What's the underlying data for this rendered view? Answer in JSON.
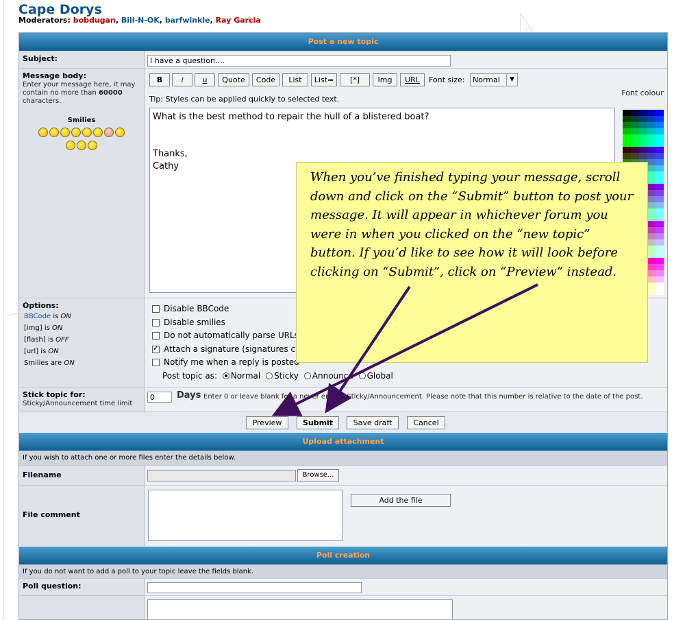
{
  "forum": {
    "title": "Cape Dorys",
    "moderators_label": "Moderators:",
    "moderators": [
      {
        "name": "bobdugan",
        "color": "#aa0000"
      },
      {
        "name": "Bill-N-OK",
        "color": "#105289"
      },
      {
        "name": "barfwinkle",
        "color": "#105289"
      },
      {
        "name": "Ray Garcia",
        "color": "#aa0000"
      }
    ]
  },
  "post": {
    "header": "Post a new topic",
    "subject_label": "Subject:",
    "subject_value": "I have a question....",
    "message_label": "Message body:",
    "message_help_1": "Enter your message here, it may contain no more than",
    "message_help_count": "60000",
    "message_help_2": "characters.",
    "smilies_label": "Smilies",
    "bbcode_buttons": [
      "B",
      "i",
      "u",
      "Quote",
      "Code",
      "List",
      "List=",
      "[*]",
      "Img",
      "URL"
    ],
    "font_size_label": "Font size:",
    "font_size_value": "Normal",
    "tip": "Tip: Styles can be applied quickly to selected text.",
    "font_colour_label": "Font colour",
    "message_lines": [
      "What is the best method to repair the hull of a blistered boat?",
      "",
      "",
      "Thanks,",
      "Cathy"
    ]
  },
  "options": {
    "label": "Options:",
    "status": [
      {
        "name": "BBCode",
        "link": true,
        "suffix": " is ",
        "state": "ON"
      },
      {
        "name": "[img]",
        "link": false,
        "suffix": " is ",
        "state": "ON"
      },
      {
        "name": "[flash]",
        "link": false,
        "suffix": " is ",
        "state": "OFF"
      },
      {
        "name": "[url]",
        "link": false,
        "suffix": " is ",
        "state": "ON"
      },
      {
        "name": "Smilies",
        "link": false,
        "suffix": " are ",
        "state": "ON"
      }
    ],
    "checkboxes": [
      {
        "label": "Disable BBCode",
        "checked": false
      },
      {
        "label": "Disable smilies",
        "checked": false
      },
      {
        "label": "Do not automatically parse URLs",
        "checked": false
      },
      {
        "label": "Attach a signature (signatures can be altered via the UCP)",
        "checked": true
      },
      {
        "label": "Notify me when a reply is posted",
        "checked": false
      }
    ],
    "post_as_label": "Post topic as:",
    "post_as_options": [
      {
        "label": "Normal",
        "selected": true
      },
      {
        "label": "Sticky",
        "selected": false
      },
      {
        "label": "Announce",
        "selected": false
      },
      {
        "label": "Global",
        "selected": false
      }
    ]
  },
  "stick": {
    "label": "Stick topic for:",
    "sub": "Sticky/Announcement time limit",
    "value": "0",
    "days_label": "Days",
    "help": "Enter 0 or leave blank for a never ending Sticky/Announcement. Please note that this number is relative to the date of the post."
  },
  "actions": {
    "preview": "Preview",
    "submit": "Submit",
    "save_draft": "Save draft",
    "cancel": "Cancel"
  },
  "upload": {
    "header": "Upload attachment",
    "intro": "If you wish to attach one or more files enter the details below.",
    "filename_label": "Filename",
    "browse": "Browse...",
    "comment_label": "File comment",
    "add_file": "Add the file"
  },
  "poll": {
    "header": "Poll creation",
    "intro": "If you do not want to add a poll to your topic leave the fields blank.",
    "question_label": "Poll question:"
  },
  "annotation": {
    "text": "When you’ve finished typing your message, scroll down and click on the “Submit” button to post your message.  It will appear in whichever forum you were in when you clicked on the “new topic” button.  If you’d like to see how it will look before clicking on “Submit”, click on “Preview” instead.",
    "arrow_color": "#3d0f5c"
  }
}
